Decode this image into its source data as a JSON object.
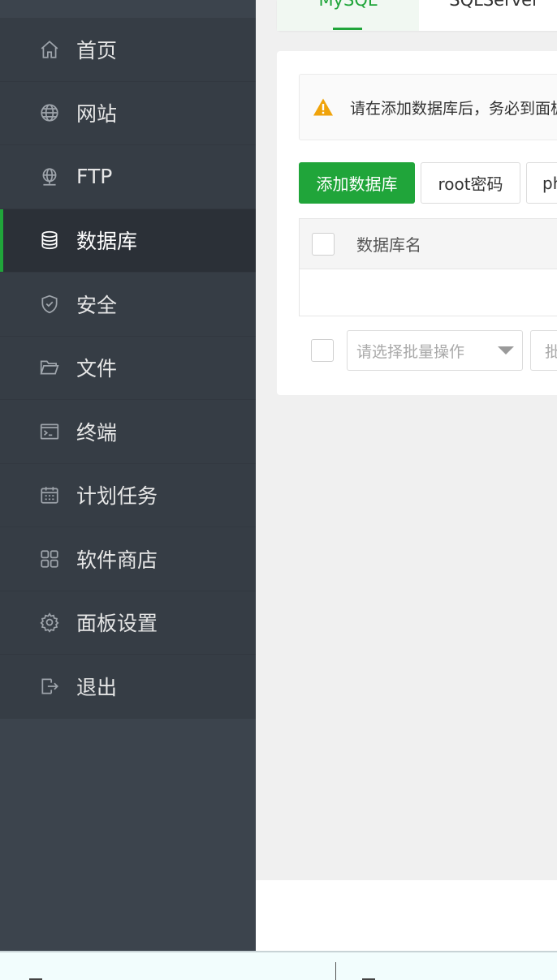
{
  "sidebar": {
    "items": [
      {
        "label": "首页",
        "icon": "home-icon"
      },
      {
        "label": "网站",
        "icon": "globe-icon"
      },
      {
        "label": "FTP",
        "icon": "ftp-icon"
      },
      {
        "label": "数据库",
        "icon": "database-icon",
        "active": true
      },
      {
        "label": "安全",
        "icon": "shield-icon"
      },
      {
        "label": "文件",
        "icon": "folder-icon"
      },
      {
        "label": "终端",
        "icon": "terminal-icon"
      },
      {
        "label": "计划任务",
        "icon": "calendar-icon"
      },
      {
        "label": "软件商店",
        "icon": "apps-grid-icon"
      },
      {
        "label": "面板设置",
        "icon": "gear-icon"
      },
      {
        "label": "退出",
        "icon": "logout-icon"
      }
    ]
  },
  "tabs": [
    {
      "label": "MySQL",
      "active": true
    },
    {
      "label": "SQLServer"
    }
  ],
  "alert": {
    "text": "请在添加数据库后，务必到面板",
    "icon": "warning-icon"
  },
  "toolbar": {
    "add_label": "添加数据库",
    "root_label": "root密码",
    "php_label": "phpMyAdmin"
  },
  "table": {
    "columns": [
      "数据库名"
    ]
  },
  "batch": {
    "select_placeholder": "请选择批量操作",
    "button_label": "批量操作"
  },
  "colors": {
    "accent": "#20a53a",
    "sidebar": "#363d45",
    "warning": "#f0a30a"
  }
}
